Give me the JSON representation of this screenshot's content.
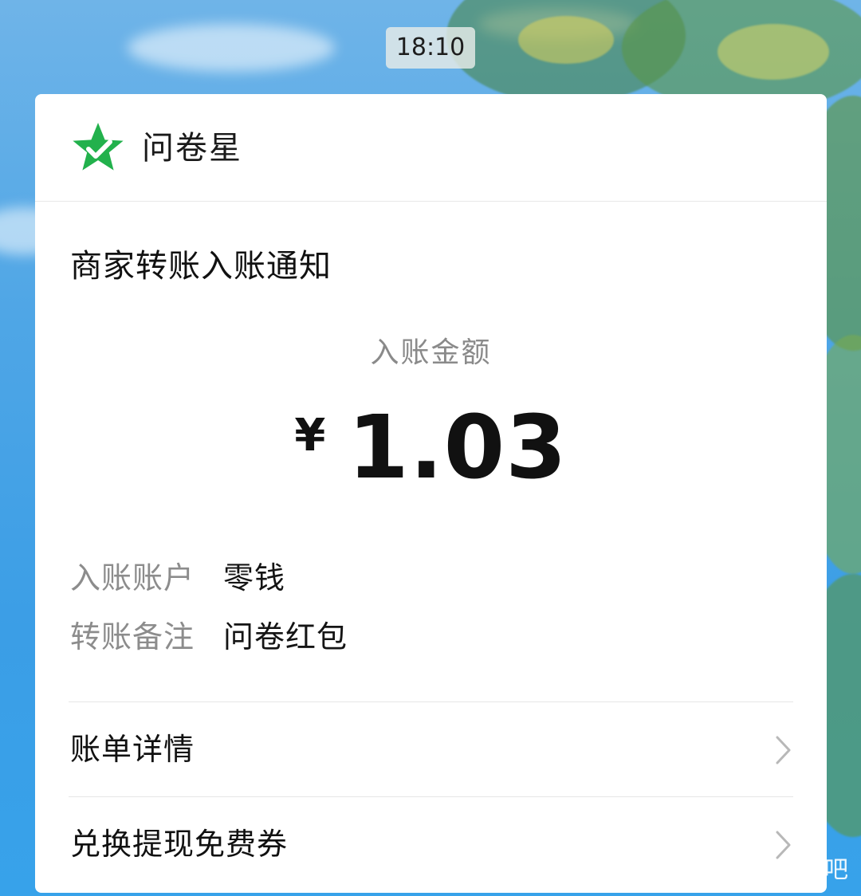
{
  "status": {
    "time": "18:10"
  },
  "app": {
    "name": "问卷星",
    "icon": "star-check-icon",
    "brand_color": "#22b14c"
  },
  "notification": {
    "title": "商家转账入账通知",
    "amount_label": "入账金额",
    "currency": "¥",
    "amount": "1.03",
    "details": [
      {
        "key": "入账账户",
        "value": "零钱"
      },
      {
        "key": "转账备注",
        "value": "问卷红包"
      }
    ],
    "links": [
      {
        "label": "账单详情",
        "icon": "chevron-right-icon"
      },
      {
        "label": "兑换提现免费券",
        "icon": "chevron-right-icon"
      }
    ]
  },
  "watermark": {
    "text": "吧"
  }
}
